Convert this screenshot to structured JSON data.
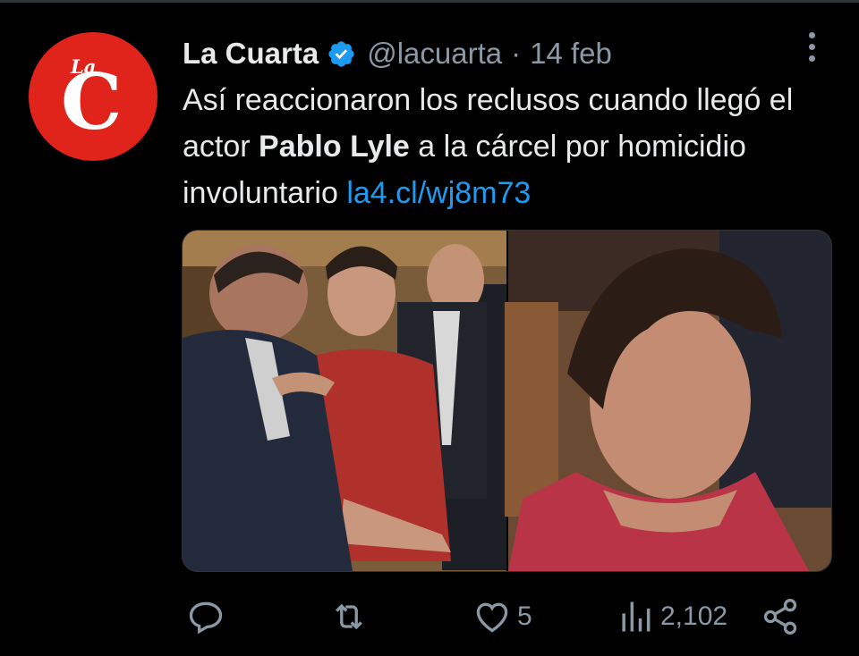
{
  "tweet": {
    "author_name": "La Cuarta",
    "handle": "@lacuarta",
    "separator": "·",
    "date": "14 feb",
    "avatar_text_small": "La",
    "avatar_text_big": "C",
    "text_part1": "Así reaccionaron los reclusos cuando llegó el actor ",
    "text_bold": "Pablo Lyle",
    "text_part2": " a la cárcel por homicidio involuntario ",
    "link": "la4.cl/wj8m73"
  },
  "actions": {
    "reply_count": "",
    "retweet_count": "",
    "like_count": "5",
    "views_count": "2,102"
  },
  "icons": {
    "verified": "verified-badge-icon",
    "more": "more-vertical-icon",
    "reply": "reply-icon",
    "retweet": "retweet-icon",
    "like": "heart-icon",
    "views": "views-bar-icon",
    "share": "share-icon"
  },
  "colors": {
    "background": "#000000",
    "accent": "#1d9bf0",
    "muted": "#8b98a5",
    "brand_red": "#e0241b"
  }
}
